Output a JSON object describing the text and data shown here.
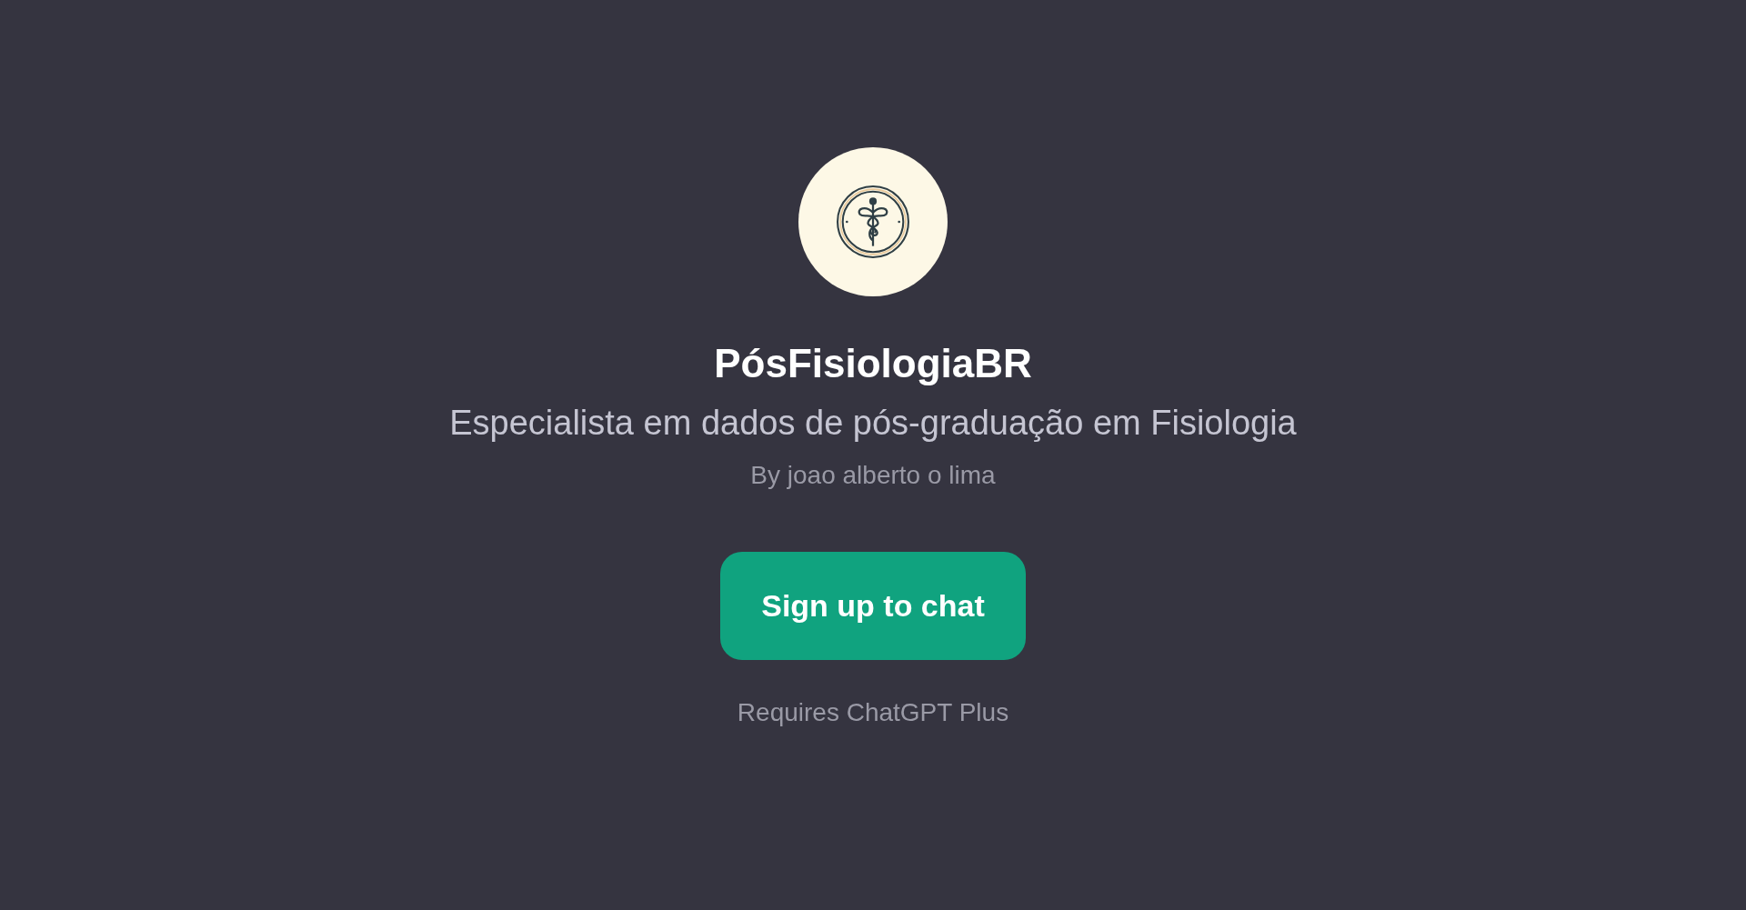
{
  "title": "PósFisiologiaBR",
  "description": "Especialista em dados de pós-graduação em Fisiologia",
  "author": "By joao alberto o lima",
  "button": "Sign up to chat",
  "note": "Requires ChatGPT Plus"
}
